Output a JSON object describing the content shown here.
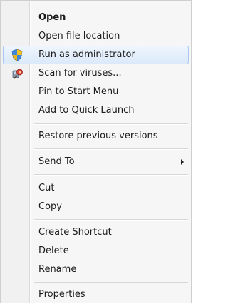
{
  "menu": {
    "items": [
      {
        "label": "Open",
        "bold": true
      },
      {
        "label": "Open file location"
      },
      {
        "label": "Run as administrator",
        "icon": "uac-shield-icon",
        "highlighted": true
      },
      {
        "label": "Scan for viruses...",
        "icon": "antivirus-scan-icon"
      },
      {
        "label": "Pin to Start Menu"
      },
      {
        "label": "Add to Quick Launch"
      },
      {
        "label": "Restore previous versions"
      },
      {
        "label": "Send To",
        "submenu_indicator": "chevron-right-icon"
      },
      {
        "label": "Cut"
      },
      {
        "label": "Copy"
      },
      {
        "label": "Create Shortcut"
      },
      {
        "label": "Delete"
      },
      {
        "label": "Rename"
      },
      {
        "label": "Properties"
      }
    ]
  },
  "colors": {
    "highlight_border": "#a9c8ef",
    "highlight_fill": "#dbe9fa",
    "menu_background": "#f6f6f6"
  }
}
